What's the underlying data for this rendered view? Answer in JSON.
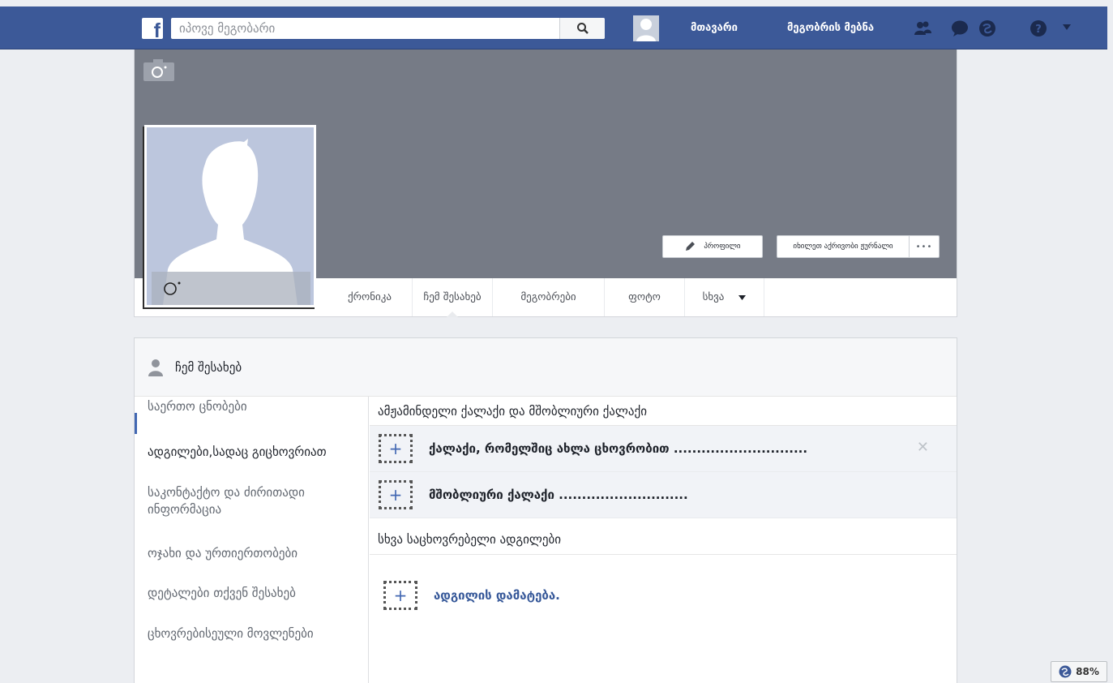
{
  "topbar": {
    "logo": "f",
    "search_placeholder": "იპოვე მეგობარი",
    "nav": [
      "მთავარი",
      "მეგობრის მებნა"
    ]
  },
  "profile": {
    "edit_button": "პროფილი",
    "activity_button": "იხილეთ აქრივობი ჟურნალი",
    "more_button": "•••",
    "tabs": [
      "ქრონიკა",
      "ჩემ შესახებ",
      "მეგობრები",
      "ფოტო",
      "სხვა"
    ]
  },
  "about": {
    "title": "ჩემ შესახებ",
    "sidebar": [
      "საერთო ცნობები",
      "ადგილები,სადაც გიცხოვრიათ",
      "საკონტაქტო და ძირითადი ინფორმაცია",
      "ოჯახი და ურთიერთობები",
      "დეტალები თქვენ შესახებ",
      "ცხოვრებისეული მოვლენები"
    ],
    "section1_title": "ამჟამინდელი ქალაქი და მშობლიური ქალაქი",
    "current_city": "ქალაქი, რომელშიც ახლა ცხოვრობით .............................",
    "hometown": "მშობლიური ქალაქი ............................",
    "section2_title": "სხვა საცხოვრებელი ადგილები",
    "add_place": "ადგილის დამატება.",
    "plus": "+",
    "close": "✕"
  },
  "zoom": "88%",
  "colors": {
    "topbar": "#3c5998",
    "cover": "#767b86",
    "link": "#365899"
  }
}
